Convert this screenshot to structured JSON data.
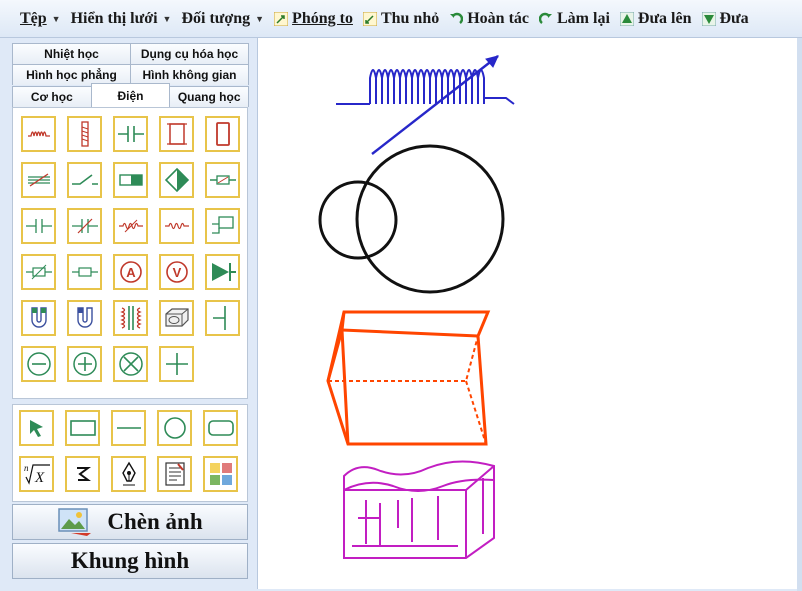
{
  "toolbar": {
    "file": "Tệp",
    "grid": "Hiển thị lưới",
    "objects": "Đối tượng",
    "zoom_in": "Phóng to",
    "zoom_out": "Thu nhỏ",
    "undo": "Hoàn tác",
    "redo": "Làm lại",
    "bring_up": "Đưa lên",
    "bring_down": "Đưa"
  },
  "tabs": {
    "row1": [
      "Nhiệt học",
      "Dụng cụ hóa học"
    ],
    "row2": [
      "Hình học phẳng",
      "Hình không gian"
    ],
    "row3": [
      "Cơ học",
      "Điện",
      "Quang học"
    ]
  },
  "buttons": {
    "insert_image": "Chèn ảnh",
    "frame": "Khung hình"
  },
  "tool_icons": {
    "electric": [
      "resistor-coil",
      "vertical-resistor",
      "capacitor",
      "rectangle-frame",
      "tall-rectangle",
      "rheostat",
      "switch",
      "battery",
      "diode-shape",
      "fuse",
      "capacitor-plates",
      "variable-capacitor",
      "variable-resistor",
      "resistor-wire",
      "circuit-box",
      "potentiometer",
      "lamp-resistor",
      "ammeter",
      "voltmeter",
      "diode",
      "u-magnet",
      "u-magnet-2",
      "transformer",
      "motor",
      "vertical-line",
      "minus-circle",
      "plus-circle",
      "cross-circle",
      "cross"
    ],
    "drawing": [
      "select-arrow",
      "rectangle",
      "line",
      "ellipse",
      "rounded-rectangle",
      "formula",
      "free-draw",
      "pen",
      "text-box",
      "image-gallery"
    ]
  },
  "colors": {
    "toolbar_bg": "#e6eef9",
    "icon_red": "#c0392b",
    "icon_green": "#2e8b57",
    "icon_border": "#e8c44a",
    "coil_blue": "#2727c9",
    "prism_orange": "#ff4500",
    "magenta": "#c21ec2"
  }
}
